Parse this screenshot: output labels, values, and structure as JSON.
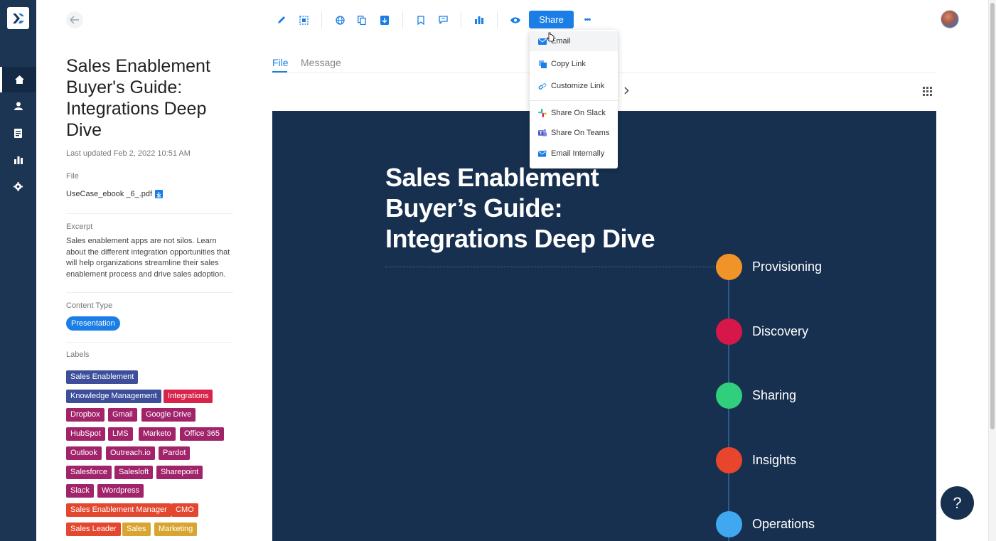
{
  "app": {
    "logo_label": "X"
  },
  "nav": {
    "items": [
      {
        "icon": "home-icon"
      },
      {
        "icon": "user-icon"
      },
      {
        "icon": "document-icon"
      },
      {
        "icon": "analytics-icon"
      },
      {
        "icon": "gear-icon"
      }
    ]
  },
  "toolbar": {
    "share_label": "Share",
    "more_label": "•••",
    "icons": [
      "edit-icon",
      "image-icon",
      "globe-icon",
      "copy-icon",
      "download-icon",
      "bookmark-icon",
      "comment-icon",
      "analytics-icon",
      "eye-icon"
    ]
  },
  "document": {
    "title": "Sales Enablement Buyer's Guide: Integrations Deep Dive",
    "last_updated": "Last updated Feb 2, 2022 10:51 AM",
    "file_label": "File",
    "file_name": "UseCase_ebook _6_.pdf",
    "excerpt_label": "Excerpt",
    "excerpt": "Sales enablement apps are not silos. Learn about the different integration opportunities that will help organizations streamline their sales enablement process and drive sales adoption.",
    "content_type_label": "Content Type",
    "content_type": "Presentation",
    "labels_label": "Labels",
    "labels": [
      {
        "text": "Sales Enablement",
        "color": "#3d4f9a"
      },
      {
        "text": "Knowledge Management",
        "color": "#3d4f9a"
      },
      {
        "text": "Integrations",
        "color": "#d8234a"
      },
      {
        "text": "Dropbox",
        "color": "#a1246b"
      },
      {
        "text": "Gmail",
        "color": "#a1246b"
      },
      {
        "text": "Google Drive",
        "color": "#a1246b"
      },
      {
        "text": "HubSpot",
        "color": "#a1246b"
      },
      {
        "text": "LMS",
        "color": "#a1246b"
      },
      {
        "text": "Marketo",
        "color": "#a1246b"
      },
      {
        "text": "Office 365",
        "color": "#a1246b"
      },
      {
        "text": "Outlook",
        "color": "#a1246b"
      },
      {
        "text": "Outreach.io",
        "color": "#a1246b"
      },
      {
        "text": "Pardot",
        "color": "#a1246b"
      },
      {
        "text": "Salesforce",
        "color": "#a1246b"
      },
      {
        "text": "Salesloft",
        "color": "#a1246b"
      },
      {
        "text": "Sharepoint",
        "color": "#a1246b"
      },
      {
        "text": "Slack",
        "color": "#a1246b"
      },
      {
        "text": "Wordpress",
        "color": "#a1246b"
      },
      {
        "text": "Sales Enablement Manager",
        "color": "#e4472f"
      },
      {
        "text": "CMO",
        "color": "#e4472f"
      },
      {
        "text": "Sales Leader",
        "color": "#e4472f"
      },
      {
        "text": "Sales",
        "color": "#d9a531"
      },
      {
        "text": "Marketing",
        "color": "#d9a531"
      }
    ]
  },
  "tabs": [
    {
      "label": "File",
      "active": true
    },
    {
      "label": "Message",
      "active": false
    }
  ],
  "slide": {
    "title": "Sales Enablement Buyer’s Guide: Integrations Deep Dive",
    "steps": [
      {
        "label": "Provisioning",
        "color": "#f0942a"
      },
      {
        "label": "Discovery",
        "color": "#d6174a"
      },
      {
        "label": "Sharing",
        "color": "#2fcf7e"
      },
      {
        "label": "Insights",
        "color": "#e8452c"
      },
      {
        "label": "Operations",
        "color": "#3fa8f0"
      }
    ]
  },
  "share_menu": {
    "items": [
      {
        "label": "Email",
        "icon": "email-icon"
      },
      {
        "label": "Copy Link",
        "icon": "copy-link-icon"
      },
      {
        "label": "Customize Link",
        "icon": "link-icon"
      },
      {
        "label": "Share On Slack",
        "icon": "slack-icon"
      },
      {
        "label": "Share On Teams",
        "icon": "teams-icon"
      },
      {
        "label": "Email Internally",
        "icon": "email-internal-icon"
      }
    ]
  },
  "help": {
    "label": "?"
  }
}
